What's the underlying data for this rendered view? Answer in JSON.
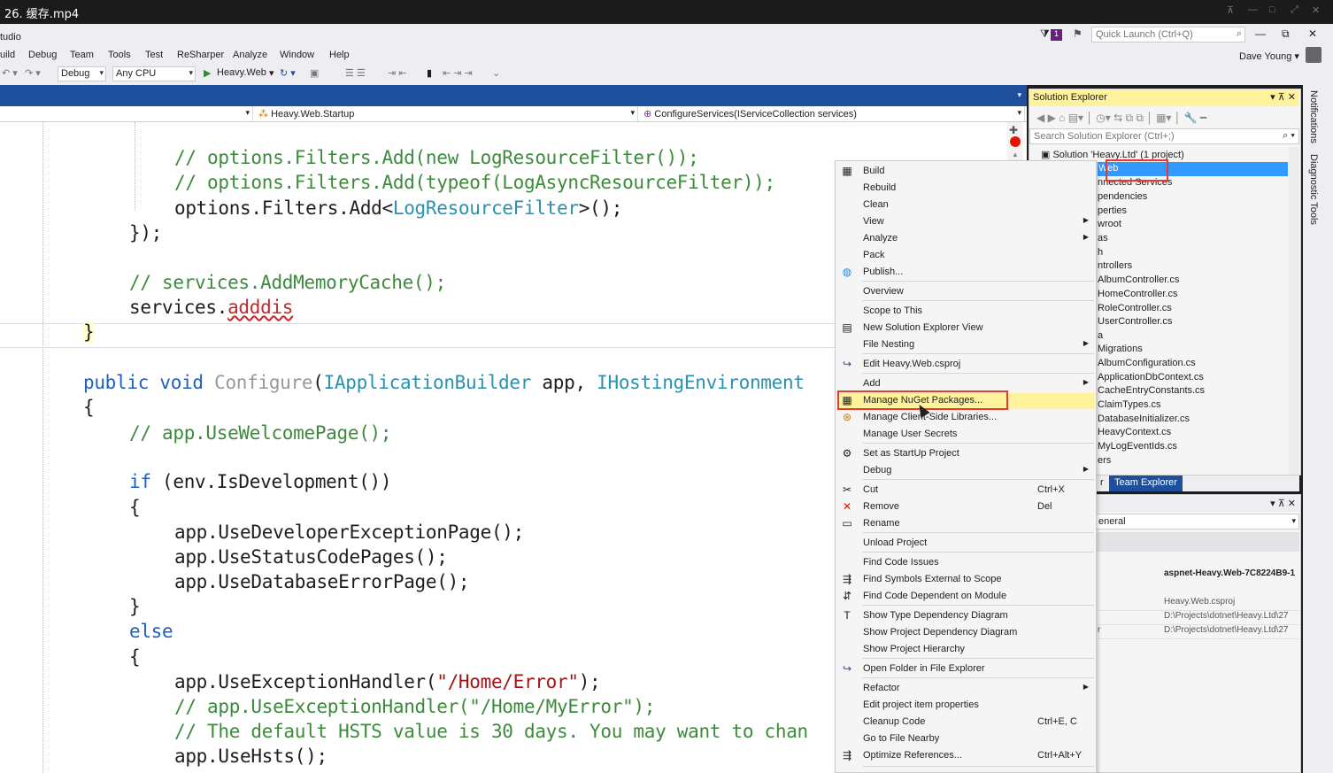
{
  "window": {
    "title": "26. 缓存.mp4",
    "studio_label": "tudio"
  },
  "menu": [
    "uild",
    "Debug",
    "Team",
    "Tools",
    "Test",
    "ReSharper",
    "Analyze",
    "Window",
    "Help"
  ],
  "toolbar": {
    "config": "Debug",
    "platform": "Any CPU",
    "run_target": "Heavy.Web"
  },
  "quick_launch": {
    "placeholder": "Quick Launch (Ctrl+Q)",
    "notif_count": "1"
  },
  "user": {
    "name": "Dave Young"
  },
  "navbar": {
    "class_dd": "Heavy.Web.Startup",
    "member_dd": "ConfigureServices(IServiceCollection services)"
  },
  "code": {
    "l1": "// options.Filters.Add(new LogResourceFilter());",
    "l2": "// options.Filters.Add(typeof(LogAsyncResourceFilter));",
    "l3a": "options.Filters.Add<",
    "l3b": "LogResourceFilter",
    "l3c": ">();",
    "l4": "});",
    "l5": "// services.AddMemoryCache();",
    "l6a": "services.",
    "l6b": "adddis",
    "l7": "}",
    "l8a": "public",
    "l8b": "void",
    "l8c": "Configure",
    "l8d": "(",
    "l8e": "IApplicationBuilder",
    "l8f": " app, ",
    "l8g": "IHostingEnvironment",
    "l9": "{",
    "l10": "// app.UseWelcomePage();",
    "l11a": "if",
    "l11b": " (env.IsDevelopment())",
    "l12": "{",
    "l13": "app.UseDeveloperExceptionPage();",
    "l14": "app.UseStatusCodePages();",
    "l15": "app.UseDatabaseErrorPage();",
    "l16": "}",
    "l17": "else",
    "l18": "{",
    "l19a": "app.UseExceptionHandler(",
    "l19b": "\"/Home/Error\"",
    "l19c": ");",
    "l20": "// app.UseExceptionHandler(\"/Home/MyError\");",
    "l21": "// The default HSTS value is 30 days. You may want to chan",
    "l22": "app.UseHsts();"
  },
  "solution_explorer": {
    "title": "Solution Explorer",
    "search_placeholder": "Search Solution Explorer (Ctrl+;)",
    "items": [
      "Solution 'Heavy.Ltd' (1 project)",
      "Web",
      "nnected Services",
      "pendencies",
      "perties",
      "wroot",
      "as",
      "h",
      "ntrollers",
      "AlbumController.cs",
      "HomeController.cs",
      "RoleController.cs",
      "UserController.cs",
      "a",
      "Migrations",
      "AlbumConfiguration.cs",
      "ApplicationDbContext.cs",
      "CacheEntryConstants.cs",
      "ClaimTypes.cs",
      "DatabaseInitializer.cs",
      "HeavyContext.cs",
      "MyLogEventIds.cs",
      "ers"
    ],
    "tab_partial": "r",
    "tab_team": "Team Explorer"
  },
  "properties": {
    "dropdown": "eneral",
    "header_value": "aspnet-Heavy.Web-7C8224B9-1",
    "rows": [
      {
        "label": "",
        "value": "Heavy.Web.csproj"
      },
      {
        "label": "",
        "value": "D:\\Projects\\dotnet\\Heavy.Ltd\\27"
      },
      {
        "label": "r",
        "value": "D:\\Projects\\dotnet\\Heavy.Ltd\\27"
      }
    ]
  },
  "side_tabs": {
    "notifications": "Notifications",
    "diagnostic": "Diagnostic Tools"
  },
  "context_menu": [
    {
      "label": "Build",
      "icon": "build-icon"
    },
    {
      "label": "Rebuild"
    },
    {
      "label": "Clean"
    },
    {
      "label": "View",
      "sub": true
    },
    {
      "label": "Analyze",
      "sub": true
    },
    {
      "label": "Pack"
    },
    {
      "label": "Publish...",
      "icon": "globe-icon"
    },
    {
      "label": "Overview"
    },
    {
      "label": "Scope to This"
    },
    {
      "label": "New Solution Explorer View",
      "icon": "new-view-icon"
    },
    {
      "label": "File Nesting",
      "sub": true
    },
    {
      "label": "Edit Heavy.Web.csproj",
      "icon": "edit-arrow-icon"
    },
    {
      "label": "Add",
      "sub": true
    },
    {
      "label": "Manage NuGet Packages...",
      "icon": "nuget-icon"
    },
    {
      "label": "Manage Client-Side Libraries...",
      "icon": "library-icon"
    },
    {
      "label": "Manage User Secrets"
    },
    {
      "label": "Set as StartUp Project",
      "icon": "gear-icon"
    },
    {
      "label": "Debug",
      "sub": true
    },
    {
      "label": "Cut",
      "icon": "scissors-icon",
      "shortcut": "Ctrl+X"
    },
    {
      "label": "Remove",
      "icon": "remove-x-icon",
      "shortcut": "Del"
    },
    {
      "label": "Rename",
      "icon": "rename-icon"
    },
    {
      "label": "Unload Project"
    },
    {
      "label": "Find Code Issues"
    },
    {
      "label": "Find Symbols External to Scope",
      "icon": "find-symbols-icon"
    },
    {
      "label": "Find Code Dependent on Module",
      "icon": "find-dependent-icon"
    },
    {
      "label": "Show Type Dependency Diagram",
      "icon": "diagram-icon"
    },
    {
      "label": "Show Project Dependency Diagram"
    },
    {
      "label": "Show Project Hierarchy"
    },
    {
      "label": "Open Folder in File Explorer",
      "icon": "open-folder-arrow-icon"
    },
    {
      "label": "Refactor",
      "sub": true
    },
    {
      "label": "Edit project item properties"
    },
    {
      "label": "Cleanup Code",
      "shortcut": "Ctrl+E, C"
    },
    {
      "label": "Go to File Nearby"
    },
    {
      "label": "Optimize References...",
      "icon": "optimize-icon",
      "shortcut": "Ctrl+Alt+Y"
    }
  ],
  "colors": {
    "accent": "#1e4f9c",
    "highlight": "#fff29d",
    "selection": "#3399ff",
    "annotation": "#e53935"
  }
}
